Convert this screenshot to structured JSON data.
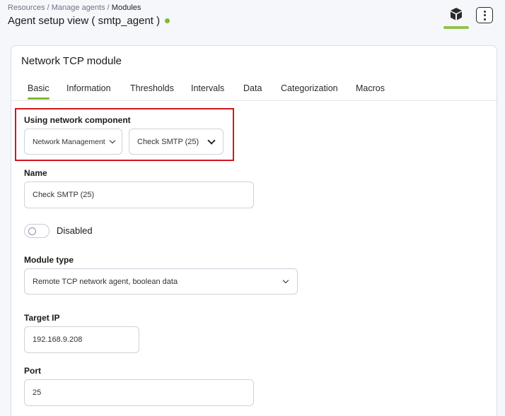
{
  "breadcrumb": {
    "items": [
      "Resources",
      "Manage agents"
    ],
    "separator": "/",
    "current": "Modules"
  },
  "page": {
    "title": "Agent setup view ( smtp_agent )"
  },
  "header": {
    "module_icon": "cube-icon",
    "menu_icon": "vertical-dots-icon",
    "accent": "#82b92e"
  },
  "card": {
    "title": "Network TCP module"
  },
  "tabs": [
    {
      "label": "Basic",
      "active": true
    },
    {
      "label": "Information"
    },
    {
      "label": "Thresholds"
    },
    {
      "label": "Intervals"
    },
    {
      "label": "Data"
    },
    {
      "label": "Categorization"
    },
    {
      "label": "Macros"
    }
  ],
  "form": {
    "network_component": {
      "label": "Using network component",
      "group_value": "Network Management",
      "component_value": "Check SMTP (25)",
      "highlight_color": "#d0171d"
    },
    "name": {
      "label": "Name",
      "value": "Check SMTP (25)"
    },
    "disabled": {
      "label": "Disabled",
      "on": false
    },
    "module_type": {
      "label": "Module type",
      "value": "Remote TCP network agent, boolean data"
    },
    "target_ip": {
      "label": "Target IP",
      "value": "192.168.9.208"
    },
    "port": {
      "label": "Port",
      "value": "25"
    }
  }
}
